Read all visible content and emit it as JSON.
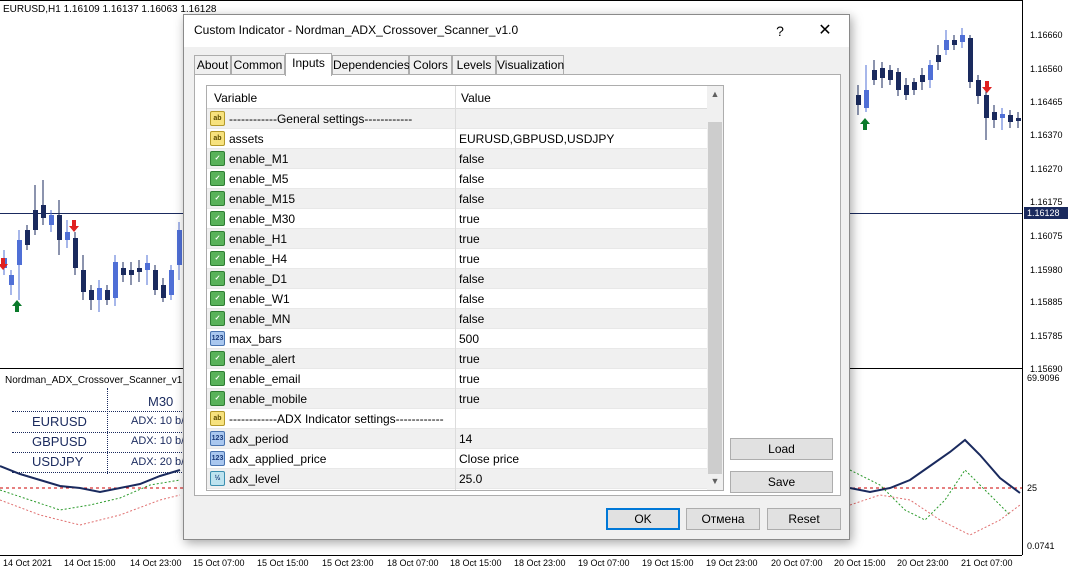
{
  "chart": {
    "caption": "EURUSD,H1  1.16109 1.16137 1.16063 1.16128",
    "current_price": "1.16128",
    "price_levels": [
      "1.16660",
      "1.16560",
      "1.16465",
      "1.16370",
      "1.16270",
      "1.16175",
      "1.16075",
      "1.15980",
      "1.15885",
      "1.15785",
      "1.15690"
    ],
    "indicator_levels": [
      "69.9096",
      "25",
      "0.0741"
    ],
    "time_labels": [
      "14 Oct 2021",
      "14 Oct 15:00",
      "14 Oct 23:00",
      "15 Oct 07:00",
      "15 Oct 15:00",
      "15 Oct 23:00",
      "18 Oct 07:00",
      "18 Oct 15:00",
      "18 Oct 23:00",
      "19 Oct 07:00",
      "19 Oct 15:00",
      "19 Oct 23:00",
      "20 Oct 07:00",
      "20 Oct 15:00",
      "20 Oct 23:00",
      "21 Oct 07:00"
    ],
    "indicator_caption": "Nordman_ADX_Crossover_Scanner_v1.0",
    "scanner": {
      "timeframe": "M30",
      "assets": [
        "EURUSD",
        "GBPUSD",
        "USDJPY"
      ],
      "cells": [
        "ADX: 10 b/",
        "ADX: 10 b/",
        "ADX: 20 b/"
      ]
    },
    "colors": {
      "bull": "#4f6fd6",
      "bear": "#1a2a5e",
      "arrow_up": "#0a7a2a",
      "arrow_down": "#e02020",
      "adx_line": "#1a2a5e",
      "level_line": "#cc0000"
    }
  },
  "dialog": {
    "title": "Custom Indicator - Nordman_ADX_Crossover_Scanner_v1.0",
    "help_label": "?",
    "close_label": "✕",
    "tabs": [
      "About",
      "Common",
      "Inputs",
      "Dependencies",
      "Colors",
      "Levels",
      "Visualization"
    ],
    "active_tab": "Inputs",
    "grid": {
      "headers": {
        "variable": "Variable",
        "value": "Value"
      },
      "rows": [
        {
          "icon": "ab",
          "variable": "------------General settings------------",
          "value": ""
        },
        {
          "icon": "ab",
          "variable": "assets",
          "value": "EURUSD,GBPUSD,USDJPY"
        },
        {
          "icon": "bool",
          "variable": "enable_M1",
          "value": "false"
        },
        {
          "icon": "bool",
          "variable": "enable_M5",
          "value": "false"
        },
        {
          "icon": "bool",
          "variable": "enable_M15",
          "value": "false"
        },
        {
          "icon": "bool",
          "variable": "enable_M30",
          "value": "true"
        },
        {
          "icon": "bool",
          "variable": "enable_H1",
          "value": "true"
        },
        {
          "icon": "bool",
          "variable": "enable_H4",
          "value": "true"
        },
        {
          "icon": "bool",
          "variable": "enable_D1",
          "value": "false"
        },
        {
          "icon": "bool",
          "variable": "enable_W1",
          "value": "false"
        },
        {
          "icon": "bool",
          "variable": "enable_MN",
          "value": "false"
        },
        {
          "icon": "num",
          "variable": "max_bars",
          "value": "500"
        },
        {
          "icon": "bool",
          "variable": "enable_alert",
          "value": "true"
        },
        {
          "icon": "bool",
          "variable": "enable_email",
          "value": "true"
        },
        {
          "icon": "bool",
          "variable": "enable_mobile",
          "value": "true"
        },
        {
          "icon": "ab",
          "variable": "------------ADX Indicator settings------------",
          "value": ""
        },
        {
          "icon": "num",
          "variable": "adx_period",
          "value": "14"
        },
        {
          "icon": "num",
          "variable": "adx_applied_price",
          "value": "Close price"
        },
        {
          "icon": "real",
          "variable": "adx_level",
          "value": "25.0"
        }
      ]
    },
    "buttons": {
      "load": "Load",
      "save": "Save",
      "ok": "OK",
      "cancel": "Отмена",
      "reset": "Reset"
    }
  }
}
